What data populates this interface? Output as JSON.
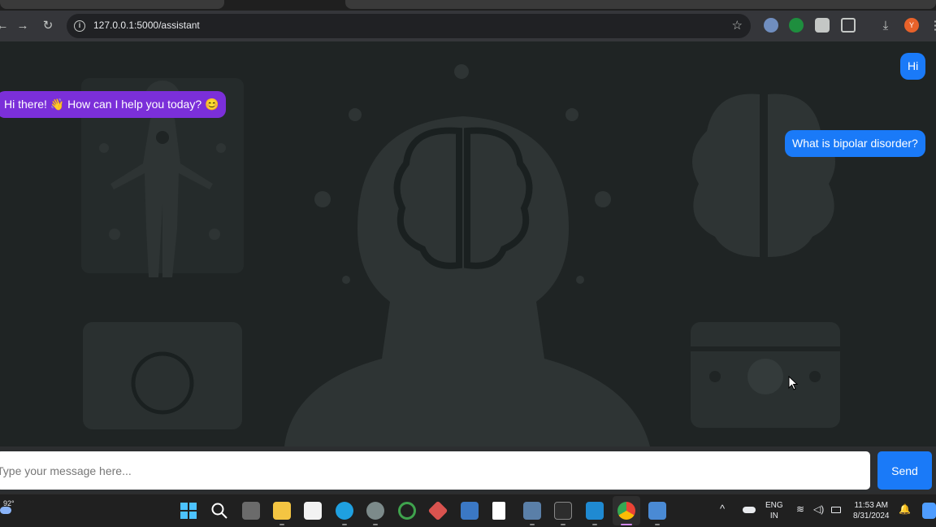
{
  "browser": {
    "url": "127.0.0.1:5000/assistant",
    "avatar_letter": "Y"
  },
  "chat": {
    "messages": [
      {
        "role": "user",
        "text": "Hi"
      },
      {
        "role": "assistant",
        "text": "Hi there! 👋 How can I help you today? 😊"
      },
      {
        "role": "user",
        "text": "What is bipolar disorder?"
      }
    ],
    "input_placeholder": "Type your message here...",
    "send_label": "Send"
  },
  "taskbar": {
    "weather_temp": "92°",
    "language_line1": "ENG",
    "language_line2": "IN",
    "time": "11:53 AM",
    "date": "8/31/2024"
  },
  "colors": {
    "user_bubble": "#1a7af8",
    "assistant_bubble": "#7b2fd9",
    "send_button": "#1a7af8",
    "page_background": "#1f2424"
  }
}
